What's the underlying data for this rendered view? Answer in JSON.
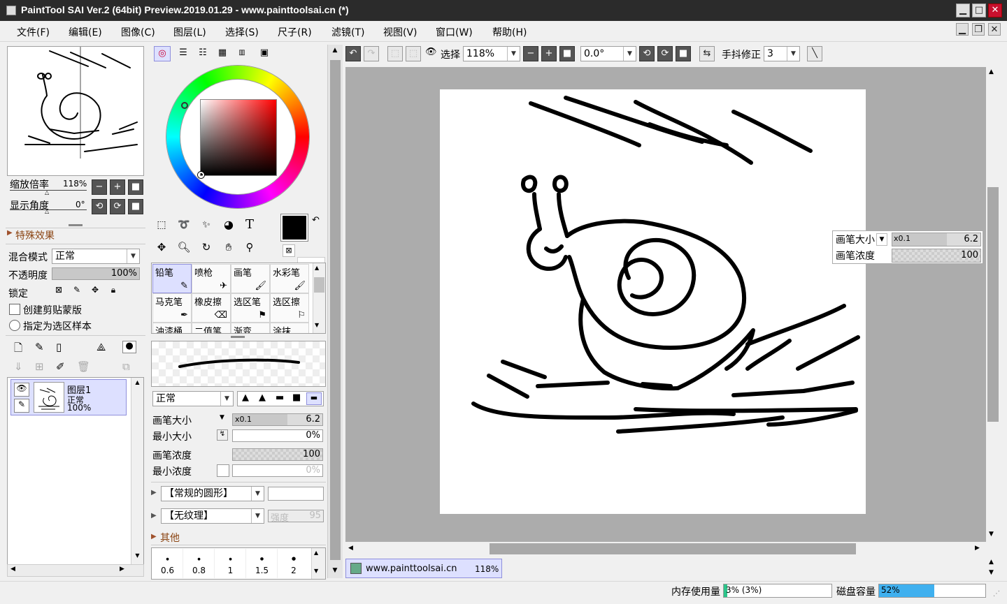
{
  "title": "PaintTool SAI Ver.2 (64bit) Preview.2019.01.29 - www.painttoolsai.cn (*)",
  "menu": [
    "文件(F)",
    "编辑(E)",
    "图像(C)",
    "图层(L)",
    "选择(S)",
    "尺子(R)",
    "滤镜(T)",
    "视图(V)",
    "窗口(W)",
    "帮助(H)"
  ],
  "navigator": {
    "zoom_label": "缩放倍率",
    "zoom_value": "118%",
    "angle_label": "显示角度",
    "angle_value": "0°"
  },
  "effects_label": "特殊效果",
  "layer_props": {
    "blend_label": "混合模式",
    "blend_value": "正常",
    "opacity_label": "不透明度",
    "opacity_value": "100%",
    "opacity_pct": 100,
    "lock_label": "锁定",
    "clip_label": "创建剪贴蒙版",
    "sample_label": "指定为选区样本"
  },
  "layer": {
    "name": "图层1",
    "mode": "正常",
    "opacity": "100%"
  },
  "tools": [
    "铅笔",
    "喷枪",
    "画笔",
    "水彩笔",
    "马克笔",
    "橡皮擦",
    "选区笔",
    "选区擦",
    "油漆桶",
    "二值笔",
    "渐变",
    "涂抹"
  ],
  "brush": {
    "mode": "正常",
    "size_label": "画笔大小",
    "size_mult": "x0.1",
    "size_value": "6.2",
    "min_size_label": "最小大小",
    "min_size_value": "0%",
    "density_label": "画笔浓度",
    "density_value": "100",
    "min_density_label": "最小浓度",
    "min_density_value": "0%",
    "shape": "【常规的圆形】",
    "texture": "【无纹理】",
    "texture_strength_label": "强度",
    "texture_strength_value": "95",
    "other_label": "其他",
    "dot_sizes": [
      "0.6",
      "0.8",
      "1",
      "1.5",
      "2"
    ]
  },
  "toolbar": {
    "select_label": "选择",
    "zoom": "118%",
    "angle": "0.0°",
    "stab_label": "手抖修正",
    "stab_value": "3"
  },
  "doc_tab": {
    "name": "www.painttoolsai.cn",
    "zoom": "118%"
  },
  "status": {
    "mem_label": "内存使用量",
    "mem_value": "3% (3%)",
    "mem_pct": 3,
    "disk_label": "磁盘容量",
    "disk_value": "52%",
    "disk_pct": 52
  },
  "colors": {
    "title_bg": "#2b2b2b",
    "accent": "#3fb0ef",
    "canvas_bg": "#acacac"
  }
}
